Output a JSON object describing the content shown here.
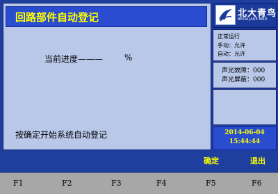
{
  "screen": {
    "title": "回路部件自动登记",
    "progress_label": "当前进度———",
    "progress_unit": "%",
    "hint": "按确定开始系统自动登记"
  },
  "logo": {
    "name_cn": "北大青鸟",
    "name_en": "BEIDA JADE BIRD",
    "icon": "jade-bird-logo-icon"
  },
  "status": {
    "mode": "正常运行",
    "manual": "手动：允许",
    "auto": "自动：允许"
  },
  "alarms": {
    "fault": "声光故障：000",
    "shield": "声光屏蔽：000"
  },
  "clock": {
    "date": "2014-06-04",
    "time": "15:44:44"
  },
  "actions": {
    "confirm": "确定",
    "exit": "退出"
  },
  "function_keys": [
    "F1",
    "F2",
    "F3",
    "F4",
    "F5",
    "F6"
  ],
  "colors": {
    "accent_text": "#ffff00",
    "panel_bg": "#b9c8e8",
    "title_bg": "#2a4dd0",
    "screen_bg": "#1f3f9f",
    "key_row_bg": "#a7a7a7"
  }
}
